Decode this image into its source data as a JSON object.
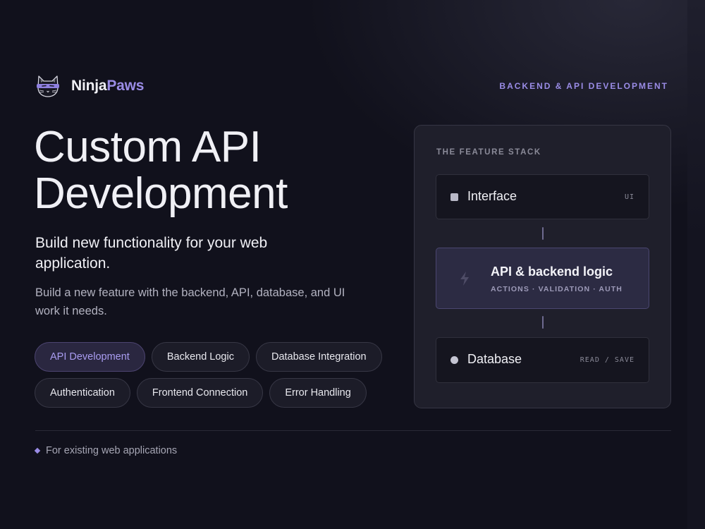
{
  "brand": {
    "name_part1": "Ninja",
    "name_part2": "Paws",
    "logo_icon": "ninja-cat-icon",
    "accent_color": "#9a8ce6"
  },
  "tagline": "BACKEND & API DEVELOPMENT",
  "hero": {
    "title_line1": "Custom API",
    "title_line2": "Development",
    "subtitle": "Build new functionality for your web application.",
    "description": "Build a new feature with the backend, API, database, and UI work it needs."
  },
  "chips": {
    "row1": [
      "API Development",
      "Backend Logic",
      "Database Integration"
    ],
    "row2": [
      "Authentication",
      "Frontend Connection",
      "Error Handling"
    ],
    "active": "API Development"
  },
  "stack": {
    "label": "THE FEATURE STACK",
    "layers": [
      {
        "name": "Interface",
        "tag": "UI",
        "icon": "square-dot-icon"
      },
      {
        "name": "API & backend logic",
        "sub": "ACTIONS · VALIDATION · AUTH",
        "icon": "bolt-icon"
      },
      {
        "name": "Database",
        "tag": "READ / SAVE",
        "icon": "circle-dot-icon"
      }
    ]
  },
  "footer": {
    "note": "For existing web applications",
    "icon": "diamond-icon"
  }
}
